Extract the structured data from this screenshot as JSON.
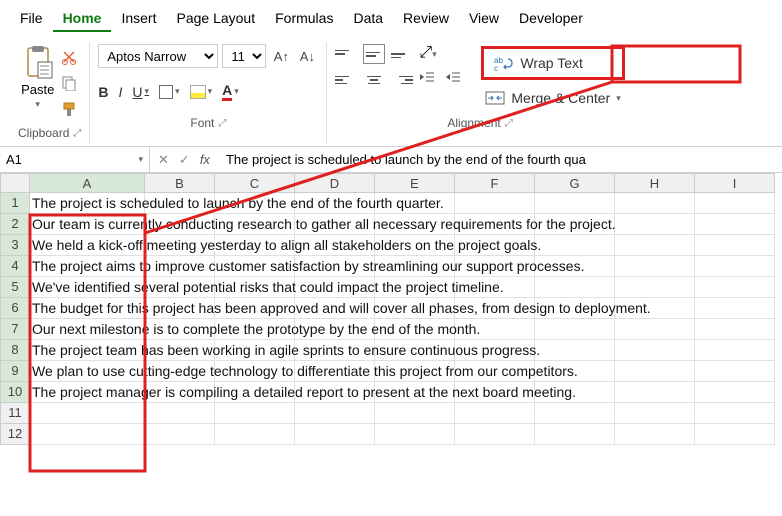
{
  "menu": {
    "items": [
      "File",
      "Home",
      "Insert",
      "Page Layout",
      "Formulas",
      "Data",
      "Review",
      "View",
      "Developer"
    ],
    "active_index": 1
  },
  "ribbon": {
    "clipboard": {
      "label": "Clipboard",
      "paste": "Paste"
    },
    "font": {
      "label": "Font",
      "name": "Aptos Narrow",
      "size": "11",
      "bold": "B",
      "italic": "I",
      "underline": "U"
    },
    "alignment": {
      "label": "Alignment",
      "wrap": "Wrap Text",
      "merge": "Merge & Center"
    }
  },
  "formula_bar": {
    "name_box": "A1",
    "content": "The project is scheduled to launch by the end of the fourth qua"
  },
  "columns": [
    "A",
    "B",
    "C",
    "D",
    "E",
    "F",
    "G",
    "H",
    "I"
  ],
  "row_numbers": [
    "1",
    "2",
    "3",
    "4",
    "5",
    "6",
    "7",
    "8",
    "9",
    "10",
    "11",
    "12"
  ],
  "cells": {
    "A1": "The project is scheduled to launch by the end of the fourth quarter.",
    "A2": "Our team is currently conducting research to gather all necessary requirements for the project.",
    "A3": "We held a kick-off meeting yesterday to align all stakeholders on the project goals.",
    "A4": "The project aims to improve customer satisfaction by streamlining our support processes.",
    "A5": "We've identified several potential risks that could impact the project timeline.",
    "A6": "The budget for this project has been approved and will cover all phases, from design to deployment.",
    "A7": "Our next milestone is to complete the prototype by the end of the month.",
    "A8": "The project team has been working in agile sprints to ensure continuous progress.",
    "A9": "We plan to use cutting-edge technology to differentiate this project from our competitors.",
    "A10": "The project manager is compiling a detailed report to present at the next board meeting."
  },
  "annotation": {
    "highlight_colA": true,
    "highlight_wrap": true,
    "colors": {
      "red": "#e02020"
    }
  }
}
